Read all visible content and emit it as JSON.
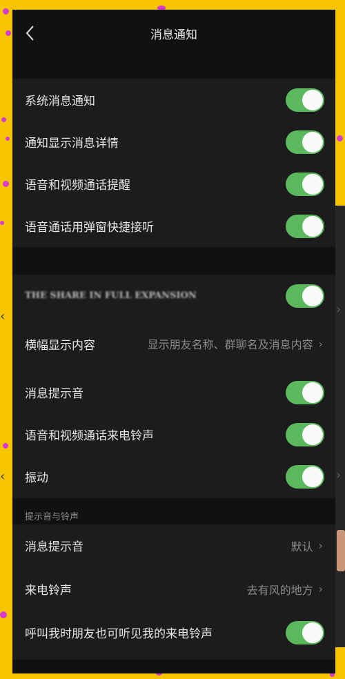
{
  "nav": {
    "title": "消息通知"
  },
  "group1": {
    "items": [
      {
        "label": "系统消息通知",
        "on": true
      },
      {
        "label": "通知显示消息详情",
        "on": true
      },
      {
        "label": "语音和视频通话提醒",
        "on": true
      },
      {
        "label": "语音通话用弹窗快捷接听",
        "on": true
      }
    ]
  },
  "group2": {
    "blurred_label": "THE SHARE IN FULL EXPANSION",
    "banner": {
      "label": "横幅显示内容",
      "value": "显示朋友名称、群聊名及消息内容"
    },
    "message_tone": {
      "label": "消息提示音",
      "on": true
    },
    "call_ringtone": {
      "label": "语音和视频通话来电铃声",
      "on": true
    },
    "vibrate": {
      "label": "振动",
      "on": true
    }
  },
  "sound_section": {
    "title": "提示音与铃声",
    "message_tone": {
      "label": "消息提示音",
      "value": "默认"
    },
    "ringtone": {
      "label": "来电铃声",
      "value": "去有风的地方"
    },
    "friends_hear": {
      "label": "呼叫我时朋友也可听见我的来电铃声",
      "on": true
    }
  },
  "colors": {
    "toggle_on": "#5cb85c",
    "background": "#111111",
    "row": "#1c1c1c",
    "frame": "#f7c500"
  }
}
